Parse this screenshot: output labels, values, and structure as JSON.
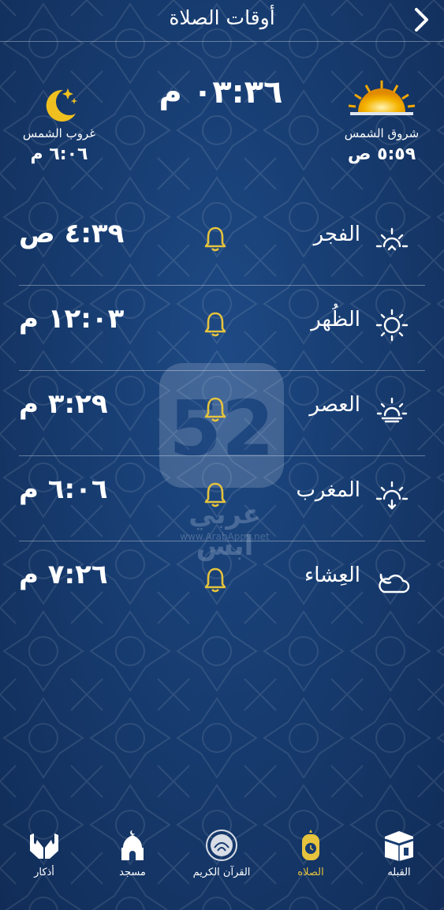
{
  "header": {
    "title": "أوقات الصلاة",
    "back_icon": "chevron-right-icon"
  },
  "current_time": "٠٣:٣٦ م",
  "sunrise": {
    "label": "شروق الشمس",
    "time": "٥:٥٩ ص",
    "icon": "sunrise-icon"
  },
  "sunset": {
    "label": "غروب الشمس",
    "time": "٦:٠٦ م",
    "icon": "moon-stars-icon"
  },
  "prayers": [
    {
      "name": "الفجر",
      "time": "٤:٣٩ ص",
      "icon": "sunrise-small-icon",
      "alarm_icon": "bell-icon"
    },
    {
      "name": "الظُهر",
      "time": "١٢:٠٣ م",
      "icon": "sun-icon",
      "alarm_icon": "bell-icon"
    },
    {
      "name": "العصر",
      "time": "٣:٢٩ م",
      "icon": "sun-low-icon",
      "alarm_icon": "bell-icon"
    },
    {
      "name": "المغرب",
      "time": "٦:٠٦ م",
      "icon": "sunset-small-icon",
      "alarm_icon": "bell-icon"
    },
    {
      "name": "العِشاء",
      "time": "٧:٢٦ م",
      "icon": "moon-cloud-icon",
      "alarm_icon": "bell-icon"
    }
  ],
  "watermark": {
    "text": "عربي ابس",
    "url": "www.ArabApps.net"
  },
  "bottom_nav": [
    {
      "label": "القبله",
      "icon": "kaaba-icon",
      "active": false
    },
    {
      "label": "الصلاه",
      "icon": "prayer-clock-icon",
      "active": true
    },
    {
      "label": "القرآن الكريم",
      "icon": "quran-icon",
      "active": false
    },
    {
      "label": "مسجد",
      "icon": "mosque-icon",
      "active": false
    },
    {
      "label": "أذكار",
      "icon": "praying-hands-icon",
      "active": false
    }
  ],
  "colors": {
    "background": "#173c70",
    "accent": "#e6c33d",
    "text": "#ffffff"
  }
}
